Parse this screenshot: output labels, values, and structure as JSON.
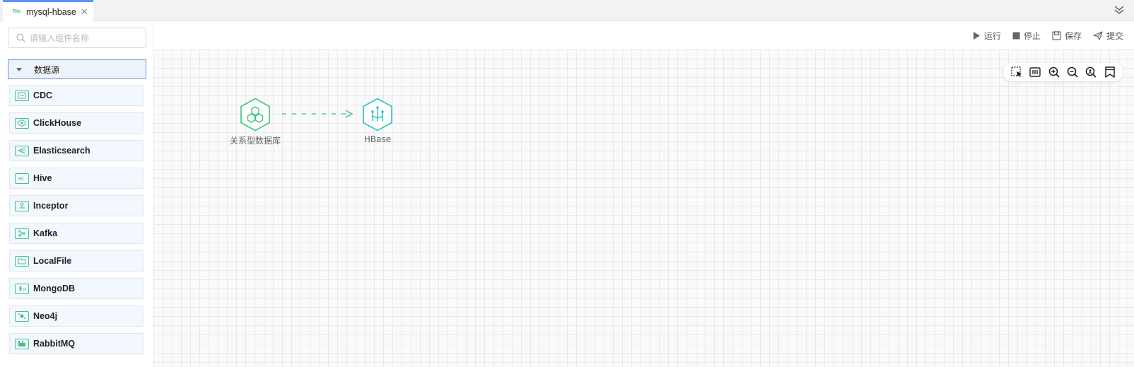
{
  "tabs": [
    {
      "label": "mysql-hbase",
      "icon": "rtx-icon",
      "icon_text": "Rtx"
    }
  ],
  "sidebar": {
    "search_placeholder": "请输入组件名称",
    "category": "数据源",
    "items": [
      {
        "label": "CDC",
        "icon": "database-icon"
      },
      {
        "label": "ClickHouse",
        "icon": "clickhouse-icon"
      },
      {
        "label": "Elasticsearch",
        "icon": "elasticsearch-icon"
      },
      {
        "label": "Hive",
        "icon": "hive-icon"
      },
      {
        "label": "Inceptor",
        "icon": "inceptor-icon"
      },
      {
        "label": "Kafka",
        "icon": "kafka-icon"
      },
      {
        "label": "LocalFile",
        "icon": "folder-icon"
      },
      {
        "label": "MongoDB",
        "icon": "mongodb-icon"
      },
      {
        "label": "Neo4j",
        "icon": "neo4j-icon"
      },
      {
        "label": "RabbitMQ",
        "icon": "rabbitmq-icon"
      }
    ]
  },
  "toolbar": {
    "run": "运行",
    "stop": "停止",
    "save": "保存",
    "submit": "提交"
  },
  "canvas": {
    "nodes": [
      {
        "label": "关系型数据库",
        "icon": "relational-db-icon",
        "color": "#3bc774"
      },
      {
        "label": "HBase",
        "icon": "hbase-icon",
        "color": "#26c6c3"
      }
    ],
    "edge_color": "#5bc7a4"
  },
  "colors": {
    "accent": "#5b8ff9",
    "item_icon": "#3fc58a"
  }
}
